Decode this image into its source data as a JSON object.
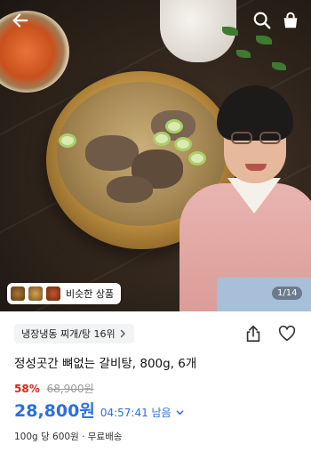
{
  "hero": {
    "pager": "1/14",
    "similar_label": "비슷한 상품",
    "icons": {
      "back": "arrow-left-icon",
      "search": "search-icon",
      "cart": "shopping-bag-icon"
    }
  },
  "product": {
    "category_rank": "냉장냉동 찌개/탕 16위",
    "title": "정성곳간 뼈없는 갈비탕, 800g, 6개",
    "discount": "58%",
    "original_price": "68,900원",
    "price": "28,800원",
    "timer": "04:57:41 남음",
    "unit_price": "100g 당 600원",
    "shipping": "· 무료배송"
  },
  "colors": {
    "price": "#2a6fe0",
    "discount": "#e0231b"
  }
}
